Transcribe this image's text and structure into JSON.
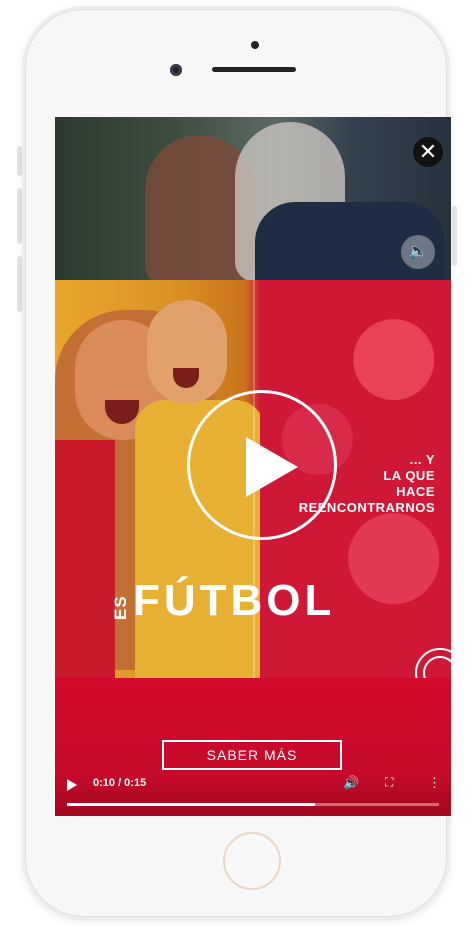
{
  "ad": {
    "close_icon": "close-icon",
    "sound_icon": "volume-icon",
    "tagline": [
      "... Y",
      "LA QUE",
      "HACE",
      "REENCONTRARNOS"
    ],
    "brand_prefix": "ES",
    "brand_main": "FÚTBOL",
    "cta_label": "SABER MÁS"
  },
  "player": {
    "time": "0:10 / 0:15",
    "progress_fraction": 0.6667,
    "play_icon": "play-icon",
    "volume_icon": "volume-icon",
    "fullscreen_icon": "fullscreen-icon",
    "more_icon": "more-options-icon"
  },
  "colors": {
    "brand_red": "#d20a2b",
    "accent_gold": "#e7b033"
  }
}
